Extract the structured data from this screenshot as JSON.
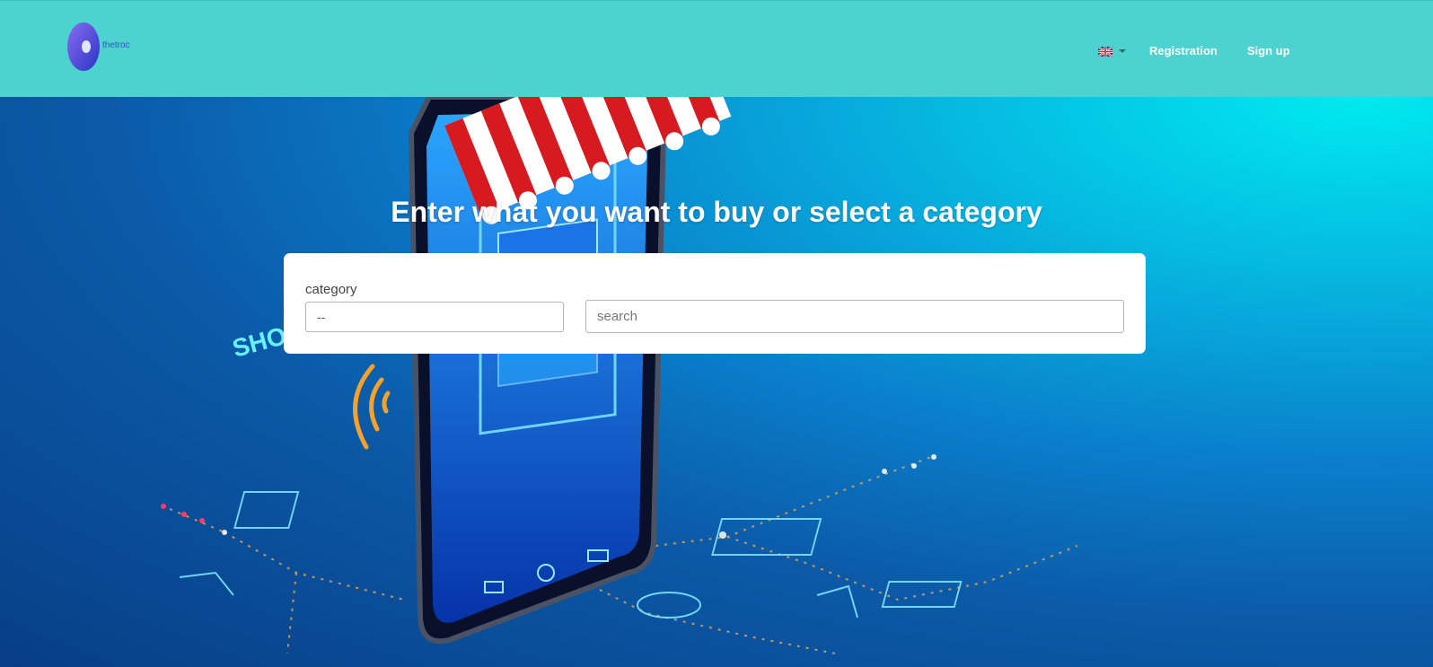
{
  "header": {
    "logo_text": "thetroc",
    "language_icon": "uk-flag-icon",
    "registration_label": "Registration",
    "signup_label": "Sign up"
  },
  "hero": {
    "title": "Enter what you want to buy or select a category",
    "category_label": "category",
    "category_value": "--",
    "search_placeholder": "search"
  },
  "colors": {
    "header_bg": "#4dd2cf",
    "hero_accent": "#00eaf0",
    "card_bg": "#ffffff"
  }
}
